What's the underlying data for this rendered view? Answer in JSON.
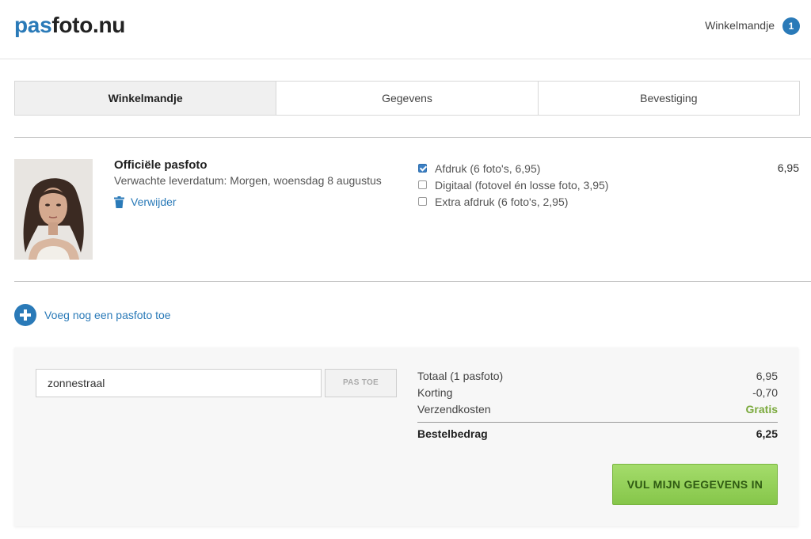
{
  "header": {
    "logo_part1": "pas",
    "logo_part2": "foto.nu",
    "cart_label": "Winkelmandje",
    "cart_count": "1"
  },
  "steps": [
    {
      "label": "Winkelmandje",
      "active": true
    },
    {
      "label": "Gegevens",
      "active": false
    },
    {
      "label": "Bevestiging",
      "active": false
    }
  ],
  "product": {
    "title": "Officiële pasfoto",
    "delivery": "Verwachte leverdatum: Morgen, woensdag 8 augustus",
    "remove_label": "Verwijder",
    "options": [
      {
        "label": "Afdruk (6 foto's, 6,95)",
        "checked": true
      },
      {
        "label": "Digitaal (fotovel én losse foto, 3,95)",
        "checked": false
      },
      {
        "label": "Extra afdruk (6 foto's, 2,95)",
        "checked": false
      }
    ],
    "price": "6,95"
  },
  "add_more_label": "Voeg nog een pasfoto toe",
  "coupon": {
    "value": "zonnestraal",
    "apply_label": "PAS TOE"
  },
  "summary": {
    "total_label": "Totaal (1 pasfoto)",
    "total_value": "6,95",
    "discount_label": "Korting",
    "discount_value": "-0,70",
    "shipping_label": "Verzendkosten",
    "shipping_value": "Gratis",
    "order_label": "Bestelbedrag",
    "order_value": "6,25"
  },
  "cta_label": "VUL MIJN GEGEVENS IN",
  "colors": {
    "brand_blue": "#2a7ab8",
    "cta_green": "#8fcd55",
    "free_green": "#7aa93c"
  }
}
